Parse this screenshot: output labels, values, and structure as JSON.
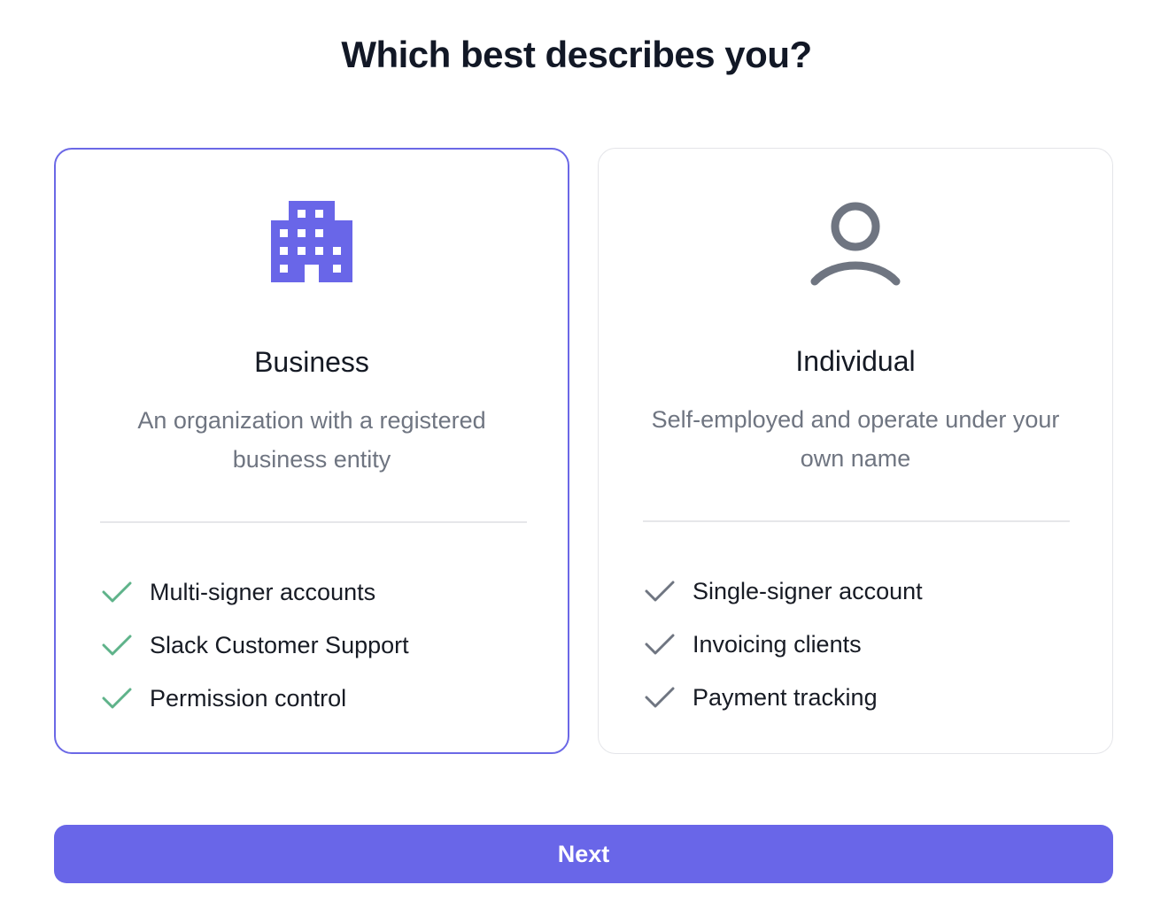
{
  "page": {
    "title": "Which best describes you?"
  },
  "options": [
    {
      "id": "business",
      "title": "Business",
      "description": "An organization with a registered business entity",
      "icon": "building-icon",
      "selected": true,
      "features": [
        "Multi-signer accounts",
        "Slack Customer Support",
        "Permission control"
      ]
    },
    {
      "id": "individual",
      "title": "Individual",
      "description": "Self-employed and operate under your own name",
      "icon": "person-icon",
      "selected": false,
      "features": [
        "Single-signer account",
        "Invoicing clients",
        "Payment tracking"
      ]
    }
  ],
  "next_button": {
    "label": "Next"
  },
  "colors": {
    "accent": "#6966e8",
    "selected_border": "#6b68e6",
    "check_selected": "#5fb38a",
    "check_unselected": "#6f7581",
    "icon_unselected": "#6f7581"
  }
}
